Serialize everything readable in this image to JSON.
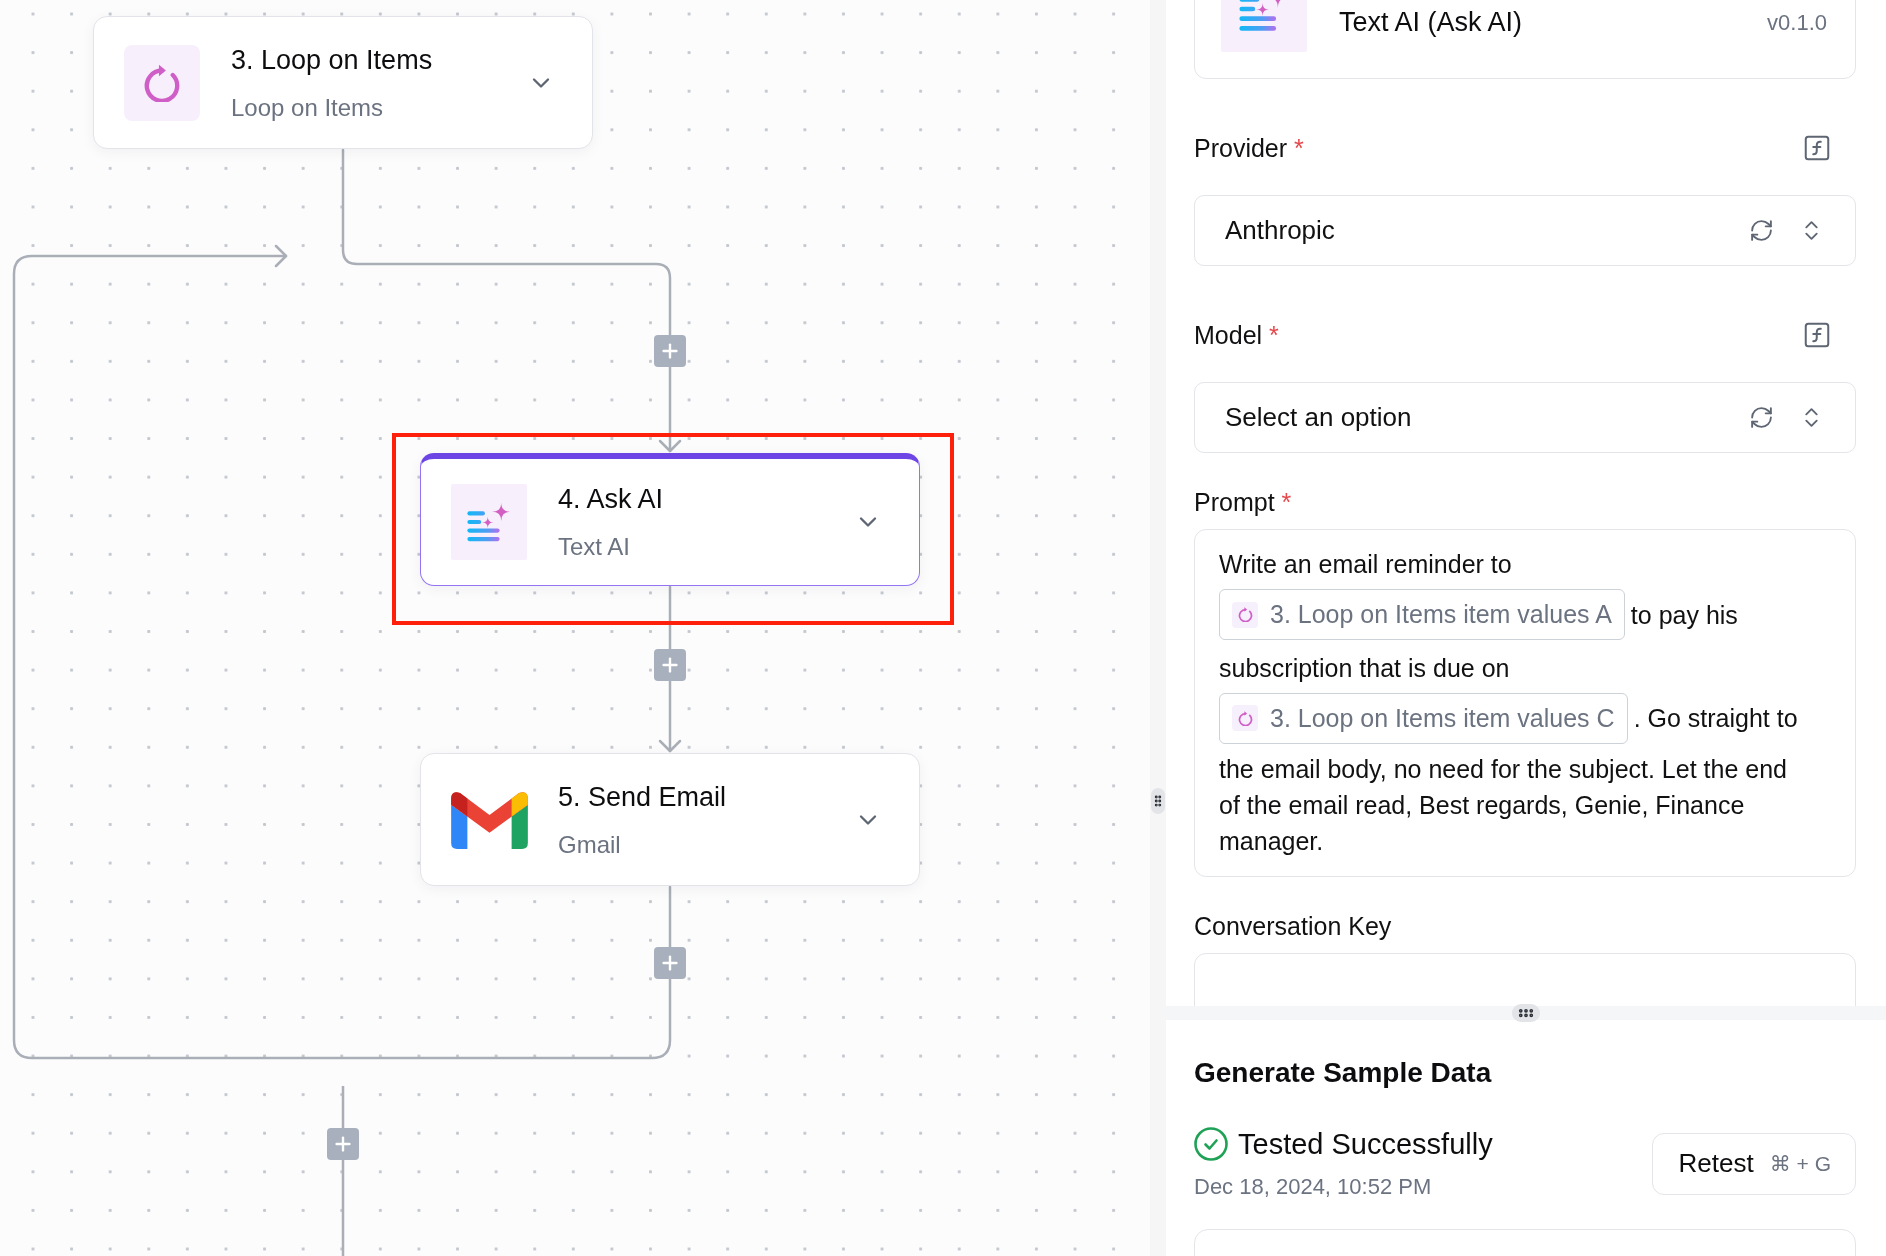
{
  "canvas": {
    "nodes": [
      {
        "kind": "loop",
        "title": "3. Loop on Items",
        "subtitle": "Loop on Items",
        "selected": false,
        "highlighted": false
      },
      {
        "kind": "ai",
        "title": "4. Ask AI",
        "subtitle": "Text AI",
        "selected": true,
        "highlighted": true
      },
      {
        "kind": "gmail",
        "title": "5. Send Email",
        "subtitle": "Gmail",
        "selected": false,
        "highlighted": false
      }
    ]
  },
  "panel": {
    "step_card": {
      "kind": "ai",
      "title": "Text AI (Ask AI)",
      "version": "v0.1.0"
    },
    "fields": [
      {
        "kind": "select",
        "label": "Provider",
        "required_mark": "*",
        "formula_toggle": true,
        "value": "Anthropic"
      },
      {
        "kind": "select",
        "label": "Model",
        "required_mark": "*",
        "formula_toggle": true,
        "placeholder": "Select an option"
      },
      {
        "kind": "rich_text",
        "label": "Prompt",
        "required_mark": "*",
        "formula_toggle": false,
        "segments": [
          {
            "kind": "text",
            "text": "Write an email reminder to"
          },
          {
            "kind": "variable",
            "text": "3. Loop on Items item values A"
          },
          {
            "kind": "text",
            "text": "to pay his"
          },
          {
            "kind": "text",
            "text": "subscription that is due on"
          },
          {
            "kind": "variable",
            "text": "3. Loop on Items item values C"
          },
          {
            "kind": "text",
            "text": ". Go straight to"
          },
          {
            "kind": "text",
            "text": "the email body, no need for the subject. Let the end of the email read, Best regards, Genie, Finance manager."
          }
        ]
      },
      {
        "kind": "text",
        "label": "Conversation Key",
        "formula_toggle": false
      }
    ],
    "sample_data": {
      "title": "Generate Sample Data",
      "status": "Tested Successfully",
      "tested": true,
      "date": "Dec 18, 2024, 10:52 PM",
      "button": {
        "label": "Retest",
        "shortcut": "⌘ + G"
      }
    }
  }
}
